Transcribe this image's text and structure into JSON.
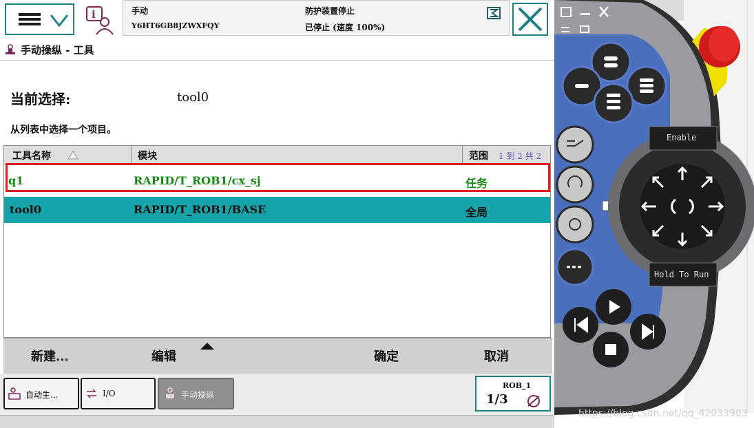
{
  "header": {
    "mode": "手动",
    "controller_id": "Y6HT6GB8JZWXFQY",
    "safety_status": "防护装置停止",
    "run_status": "已停止 (速度 100%)"
  },
  "page": {
    "title": "手动操纵 - 工具"
  },
  "selection": {
    "label": "当前选择:",
    "value": "tool0"
  },
  "instruction": "从列表中选择一个项目。",
  "table": {
    "columns": [
      "工具名称",
      "模块",
      "范围"
    ],
    "paging": "1 到 2 共 2",
    "rows": [
      {
        "name": "q1",
        "module": "RAPID/T_ROB1/cx_sj",
        "scope": "任务"
      },
      {
        "name": "tool0",
        "module": "RAPID/T_ROB1/BASE",
        "scope": "全局"
      }
    ]
  },
  "commands": {
    "new": "新建...",
    "edit": "编辑",
    "ok": "确定",
    "cancel": "取消"
  },
  "taskbar": {
    "items": [
      "自动生...",
      "I/O",
      "手动操纵"
    ],
    "robot": "ROB_1",
    "fraction": "1/3"
  },
  "pendant": {
    "enable_label": "Enable",
    "hold_label": "Hold To Run"
  },
  "watermark": "https://blog.csdn.net/qq_42033903",
  "colors": {
    "accent": "#1f7f86",
    "selected_row": "#14a4a9",
    "task_text": "#1a8a1a",
    "highlight": "#d92020"
  }
}
